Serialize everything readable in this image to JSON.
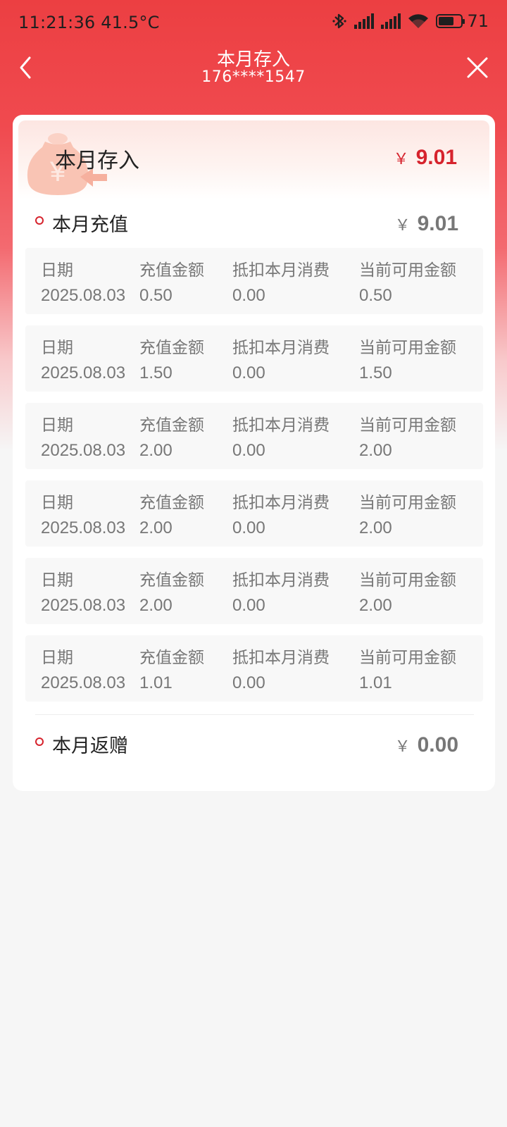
{
  "status_bar": {
    "time": "11:21:36 41.5°C",
    "battery": "71",
    "battery_level": 0.71,
    "icons": [
      "bluetooth-icon",
      "signal-icon",
      "signal-icon",
      "wifi-icon",
      "battery-icon"
    ]
  },
  "nav": {
    "title": "本月存入",
    "subtitle": "176****1547",
    "back_icon": "chevron-left-icon",
    "close_icon": "close-icon"
  },
  "summary": {
    "label": "本月存入",
    "currency": "￥",
    "amount": "9.01",
    "amount_color": "#d6232d"
  },
  "recharge": {
    "label": "本月充值",
    "currency": "￥",
    "amount": "9.01",
    "columns": [
      "日期",
      "充值金额",
      "抵扣本月消费",
      "当前可用金额"
    ],
    "rows": [
      [
        "2025.08.03",
        "0.50",
        "0.00",
        "0.50"
      ],
      [
        "2025.08.03",
        "1.50",
        "0.00",
        "1.50"
      ],
      [
        "2025.08.03",
        "2.00",
        "0.00",
        "2.00"
      ],
      [
        "2025.08.03",
        "2.00",
        "0.00",
        "2.00"
      ],
      [
        "2025.08.03",
        "2.00",
        "0.00",
        "2.00"
      ],
      [
        "2025.08.03",
        "1.01",
        "0.00",
        "1.01"
      ]
    ]
  },
  "rebate": {
    "label": "本月返赠",
    "currency": "￥",
    "amount": "0.00"
  },
  "colors": {
    "brand_red": "#ec3f42",
    "accent_red": "#d6232d",
    "muted_text": "#777777"
  }
}
